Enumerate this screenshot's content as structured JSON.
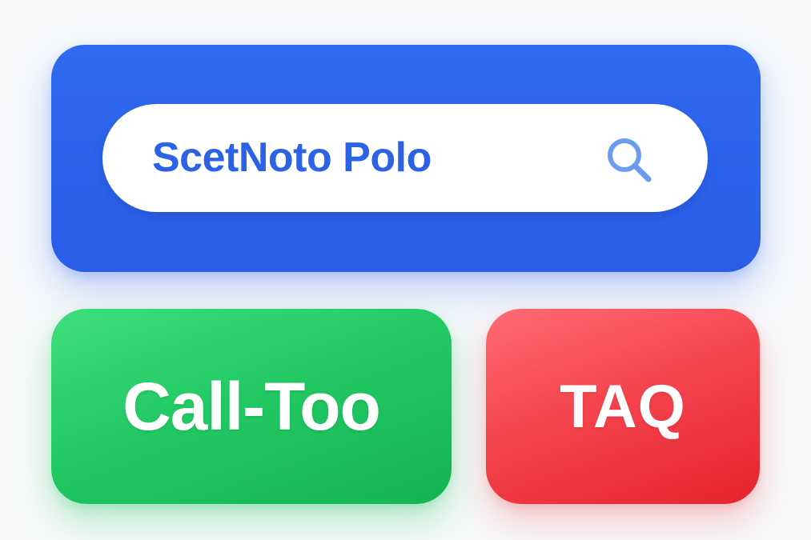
{
  "search_card": {
    "search_value": "ScetNoto Polo",
    "search_icon": "search-icon",
    "accent_color": "#2d63ec"
  },
  "green_button": {
    "label": "Call-Too",
    "color": "#22c55e"
  },
  "red_button": {
    "label": "TAQ",
    "color": "#ef4444"
  }
}
